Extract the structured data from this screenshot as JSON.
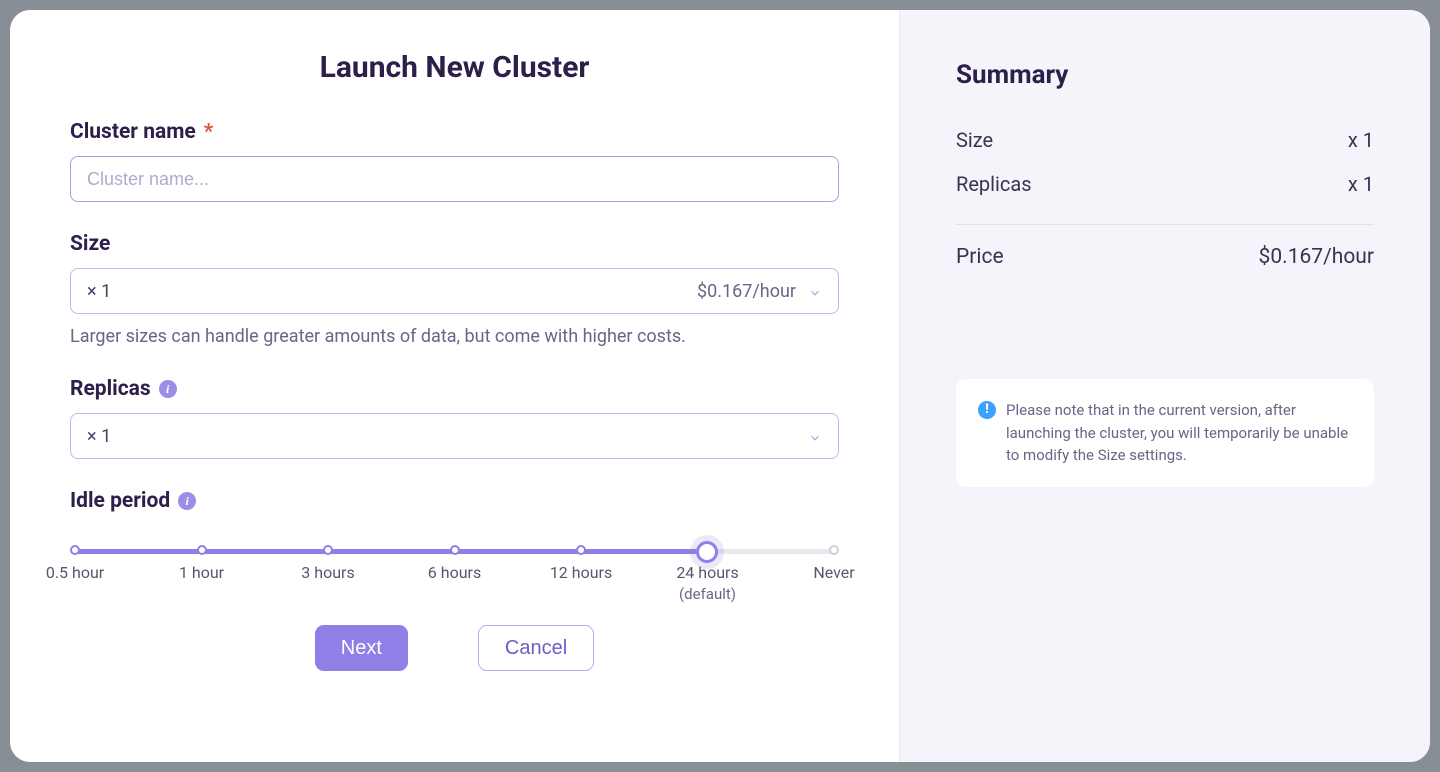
{
  "title": "Launch New Cluster",
  "clusterName": {
    "label": "Cluster name",
    "required": "*",
    "placeholder": "Cluster name..."
  },
  "size": {
    "label": "Size",
    "value": "× 1",
    "price": "$0.167/hour",
    "helper": "Larger sizes can handle greater amounts of data, but come with higher costs."
  },
  "replicas": {
    "label": "Replicas",
    "value": "× 1"
  },
  "idle": {
    "label": "Idle period",
    "ticks": [
      "0.5 hour",
      "1 hour",
      "3 hours",
      "6 hours",
      "12 hours",
      "24 hours",
      "Never"
    ],
    "defaultSub": "(default)",
    "selectedIndex": 5
  },
  "actions": {
    "next": "Next",
    "cancel": "Cancel"
  },
  "summary": {
    "title": "Summary",
    "sizeLabel": "Size",
    "sizeValue": "x 1",
    "replicasLabel": "Replicas",
    "replicasValue": "x 1",
    "priceLabel": "Price",
    "priceValue": "$0.167/hour"
  },
  "note": "Please note that in the current version, after launching the cluster, you will temporarily be unable to modify the Size settings."
}
